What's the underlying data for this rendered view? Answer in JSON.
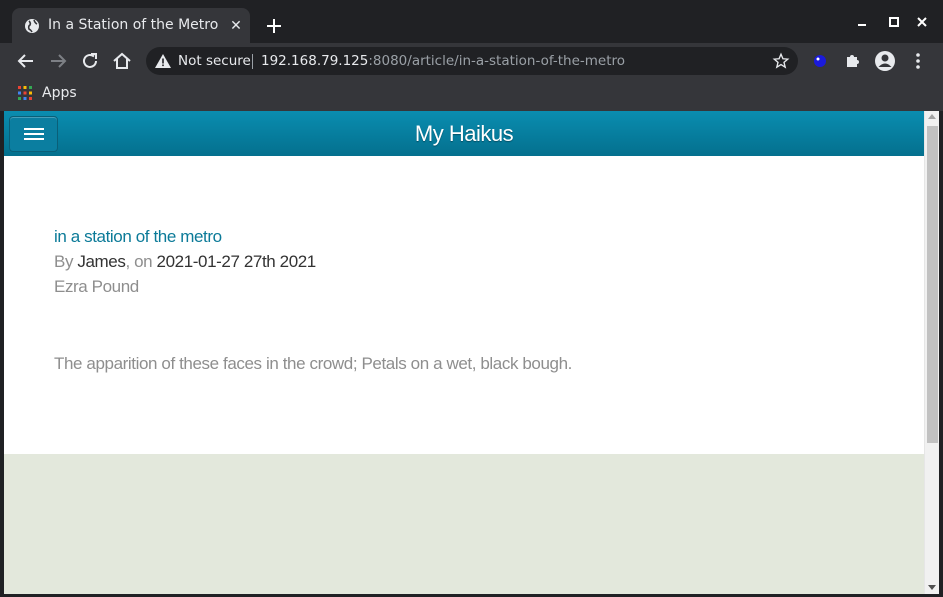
{
  "browser": {
    "tab": {
      "title": "In a Station of the Metro",
      "close": "✕"
    },
    "omnibox": {
      "security_label": "Not secure",
      "url_host": "192.168.79.125",
      "url_path": ":8080/article/in-a-station-of-the-metro"
    },
    "bookmarks": {
      "apps_label": "Apps"
    }
  },
  "site": {
    "title": "My Haikus"
  },
  "article": {
    "title": "in a station of the metro",
    "by_prefix": "By ",
    "author": "James",
    "on_prefix": ", on ",
    "date": "2021-01-27 27th 2021",
    "subtitle": "Ezra Pound",
    "body": "The apparition of these faces in the crowd; Petals on a wet, black bough."
  },
  "colors": {
    "header": "#04708e",
    "link": "#0b7a98",
    "footer": "#e3e8dc"
  }
}
